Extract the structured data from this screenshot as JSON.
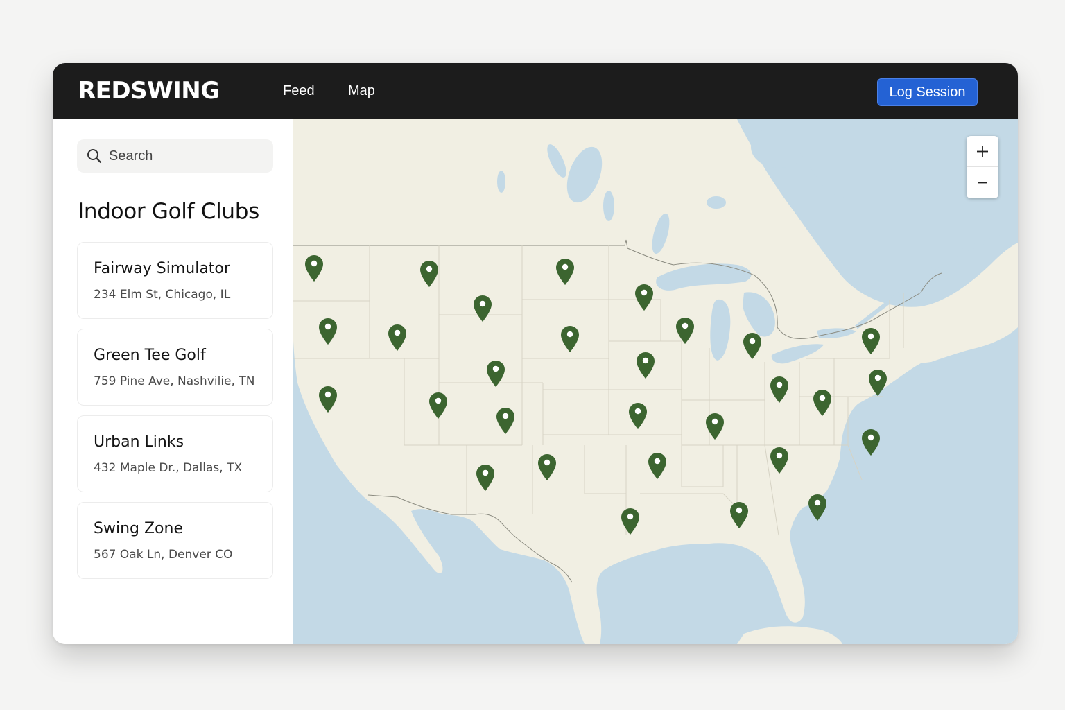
{
  "header": {
    "brand": "REDSWING",
    "nav": [
      {
        "label": "Feed"
      },
      {
        "label": "Map"
      }
    ],
    "log_session_label": "Log Session"
  },
  "sidebar": {
    "search": {
      "placeholder": "Search",
      "value": ""
    },
    "title": "Indoor Golf Clubs",
    "clubs": [
      {
        "name": "Fairway Simulator",
        "address": "234 Elm St, Chicago, IL"
      },
      {
        "name": "Green Tee Golf",
        "address": "759 Pine Ave, Nashvilie, TN"
      },
      {
        "name": "Urban Links",
        "address": "432 Maple Dr., Dallas, TX"
      },
      {
        "name": "Swing Zone",
        "address": "567 Oak Ln, Denver CO"
      }
    ]
  },
  "map": {
    "colors": {
      "land": "#f1efe3",
      "water": "#c3d9e6",
      "pin": "#3c6530",
      "border": "#cfcdbf"
    },
    "icons": {
      "pin": "map-pin-icon",
      "zoom_in": "plus-icon",
      "zoom_out": "minus-icon"
    }
  }
}
